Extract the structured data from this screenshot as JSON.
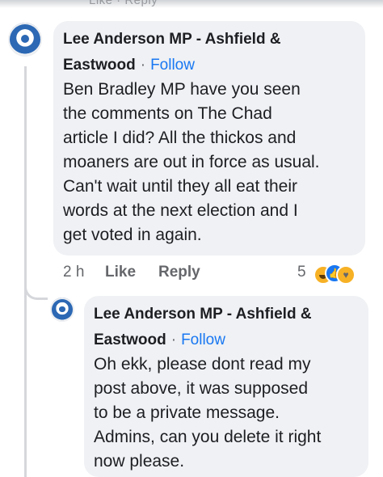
{
  "top_fragment": "Like · Reply",
  "comments": [
    {
      "author_line1": "Lee Anderson MP - Ashfield &",
      "author_line2": "Eastwood",
      "follow": "Follow",
      "text": "Ben Bradley MP have you seen\nthe comments on The Chad\narticle I did? All the thickos and\nmoaners are out in force as usual.\nCan't wait until they all eat their\nwords at the next election and I\nget voted in again.",
      "time": "2 h",
      "like_label": "Like",
      "reply_label": "Reply",
      "reaction_count": "5",
      "reactions": [
        "haha",
        "like",
        "care"
      ]
    },
    {
      "author_line1": "Lee Anderson MP - Ashfield &",
      "author_line2": "Eastwood",
      "follow": "Follow",
      "text": "Oh ekk, please dont read my\npost above, it was supposed\nto be a private message.\nAdmins, can you delete it right\nnow please."
    }
  ],
  "colors": {
    "bubble": "#eff1f4",
    "link": "#1877f2",
    "meta": "#65676b",
    "text": "#1c1e21"
  }
}
